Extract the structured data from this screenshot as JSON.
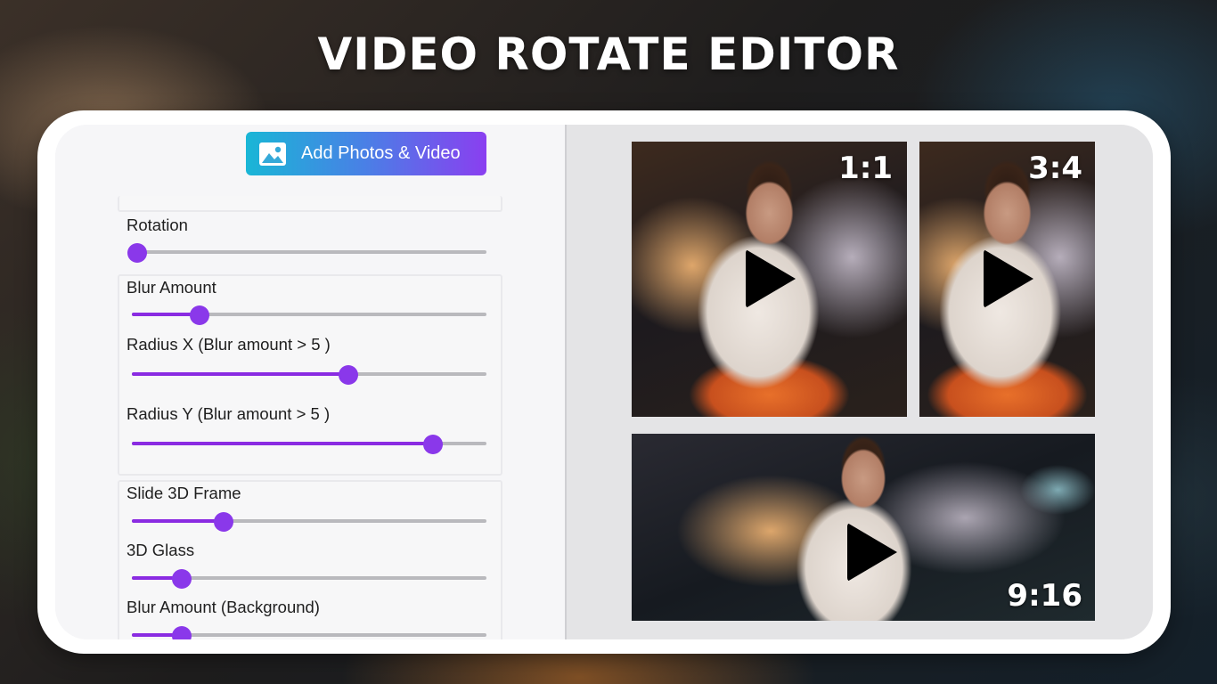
{
  "banner": {
    "title": "VIDEO ROTATE EDITOR"
  },
  "toolbar": {
    "add_button_label": "Add Photos & Video",
    "add_button_icon": "image-icon"
  },
  "controls": {
    "rotation": {
      "label": "Rotation",
      "value": 0.0
    },
    "blur_amount": {
      "label": "Blur Amount",
      "value": 0.19
    },
    "radius_x": {
      "label": "Radius X  (Blur amount > 5 )",
      "value": 0.61
    },
    "radius_y": {
      "label": "Radius Y  (Blur amount > 5 )",
      "value": 0.85
    },
    "slide_3d_frame": {
      "label": "Slide 3D Frame",
      "value": 0.26
    },
    "glass_3d": {
      "label": "3D Glass",
      "value": 0.14
    },
    "blur_background": {
      "label": "Blur Amount (Background)",
      "value": 0.14
    }
  },
  "previews": [
    {
      "ratio": "1:1",
      "icon": "play-icon"
    },
    {
      "ratio": "3:4",
      "icon": "play-icon"
    },
    {
      "ratio": "9:16",
      "icon": "play-icon"
    }
  ],
  "colors": {
    "accent": "#8a2be2",
    "button_gradient_start": "#19b6d6",
    "button_gradient_end": "#8a3ff0",
    "track": "#b9b9bd"
  }
}
